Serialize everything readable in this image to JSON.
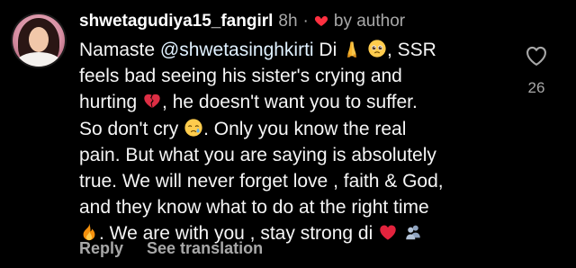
{
  "comment": {
    "username": "shwetagudiya15_fangirl",
    "time": "8h",
    "separator": "·",
    "author_badge": "by author",
    "lines": [
      {
        "pre": "Namaste ",
        "mention": "@shwetasinghkirti",
        "post": " Di",
        "tail": ", SSR"
      },
      {
        "text": "feels bad seeing his sister's crying and"
      },
      {
        "pre": "hurting ",
        "post": ", he doesn't want you to suffer."
      },
      {
        "pre": "So don't cry ",
        "post": ". Only you know the real"
      },
      {
        "text": "pain. But what you are saying is absolutely"
      },
      {
        "text": "true. We will never forget love , faith & God,"
      },
      {
        "text": "and they know what to do at the right time"
      },
      {
        "post": ". We are with you , stay strong di "
      }
    ],
    "emojis": [
      "folded-hands",
      "pleading-face",
      "broken-heart",
      "crying-face",
      "fire",
      "red-heart",
      "people-silhouettes"
    ]
  },
  "actions": {
    "reply": "Reply",
    "see_translation": "See translation"
  },
  "likes": {
    "count": "26"
  },
  "colors": {
    "background": "#000000",
    "text": "#f5f5f5",
    "muted": "#a8a8a8",
    "author_heart": "#ff3040"
  }
}
